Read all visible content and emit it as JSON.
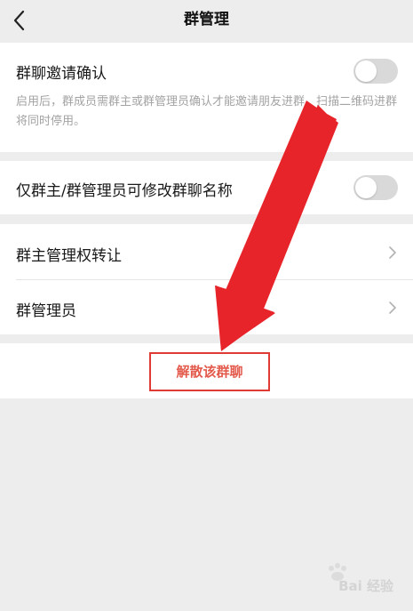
{
  "header": {
    "title": "群管理"
  },
  "settings": {
    "invite_confirm": {
      "label": "群聊邀请确认",
      "description": "启用后，群成员需群主或群管理员确认才能邀请朋友进群。扫描二维码进群将同时停用。",
      "enabled": false
    },
    "rename_restrict": {
      "label": "仅群主/群管理员可修改群聊名称",
      "enabled": false
    },
    "transfer_owner": {
      "label": "群主管理权转让"
    },
    "admins": {
      "label": "群管理员"
    }
  },
  "actions": {
    "dissolve_label": "解散该群聊"
  },
  "colors": {
    "background": "#ededed",
    "card": "#ffffff",
    "toggle_off": "#d9d9d9",
    "danger": "#e35a4c",
    "annotation_red": "#e8242b"
  },
  "watermark": {
    "text": "Bai 经验"
  }
}
